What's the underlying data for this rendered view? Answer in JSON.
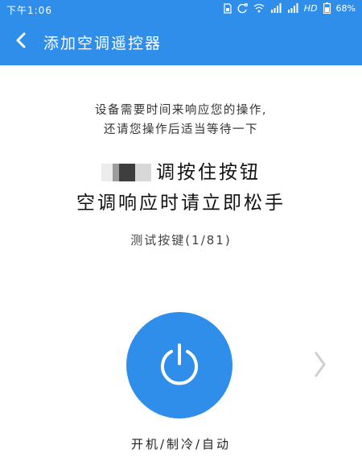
{
  "status_bar": {
    "time": "下午1:06",
    "network": "HD",
    "battery": "68%"
  },
  "app_bar": {
    "title": "添加空调遥控器"
  },
  "notice": {
    "line1": "设备需要时间来响应您的操作,",
    "line2": "还请您操作后适当等待一下"
  },
  "prompt": {
    "line1_suffix": "调按住按钮",
    "line2": "空调响应时请立即松手"
  },
  "test": {
    "label": "测试按键(1/81)"
  },
  "power_button": {
    "icon": "power-icon",
    "color": "#2f8eea"
  },
  "mode": {
    "label": "开机/制冷/自动"
  },
  "colors": {
    "accent": "#2f8eea",
    "chevron": "#d0d0d0"
  }
}
